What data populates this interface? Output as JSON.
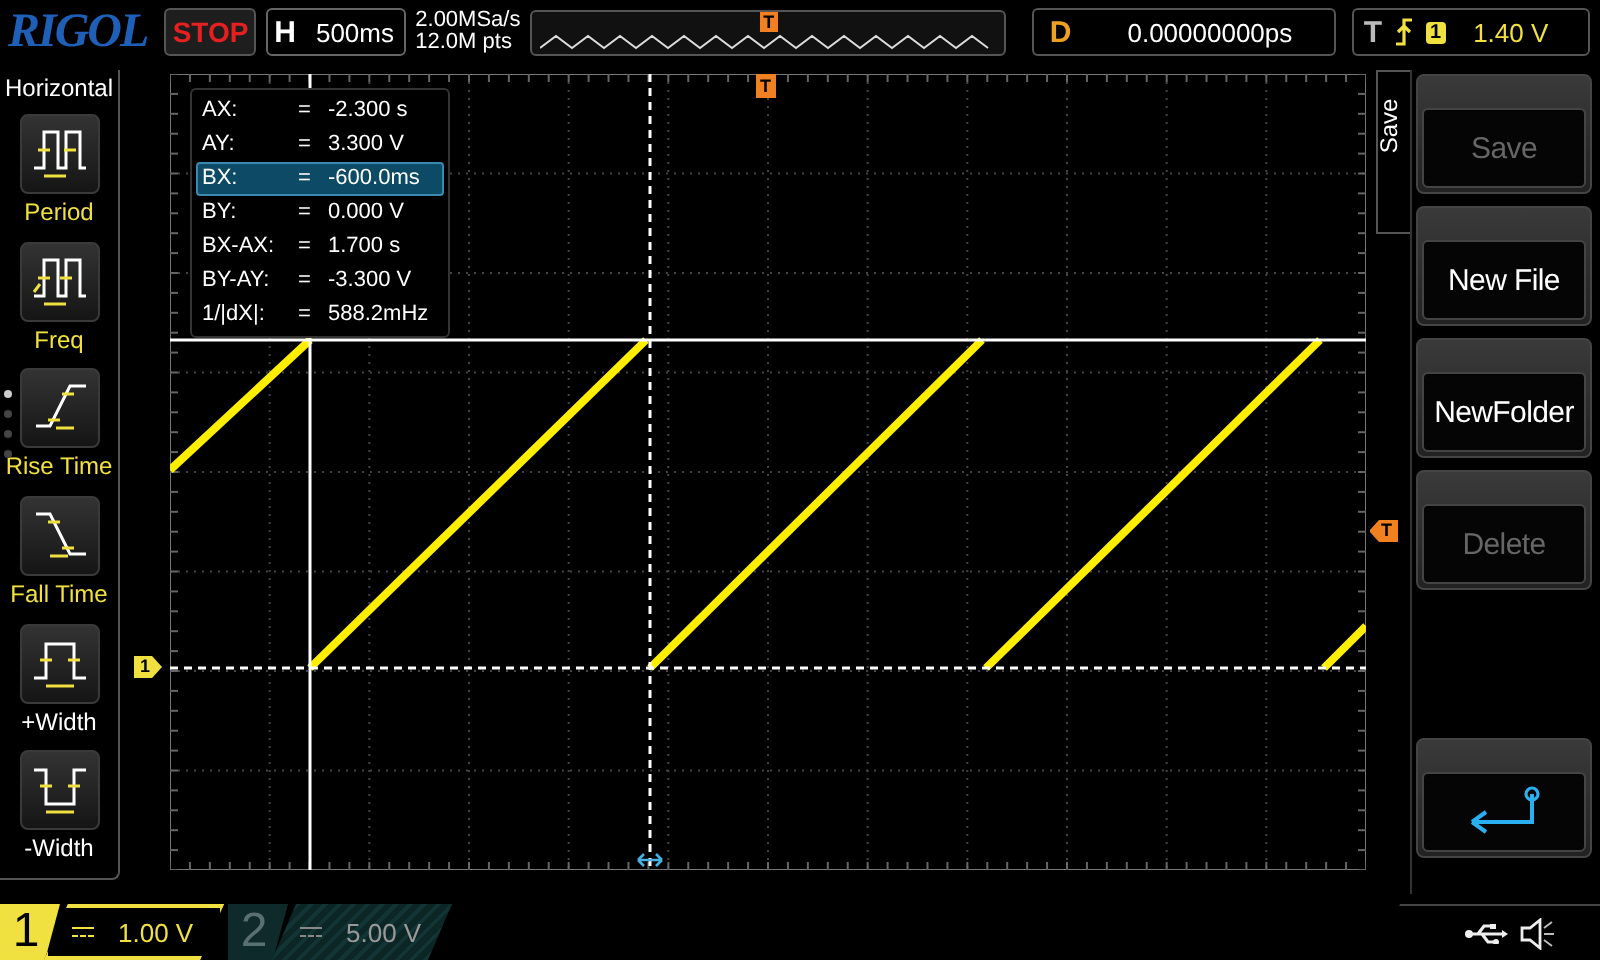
{
  "brand": "RIGOL",
  "run_state": {
    "label": "STOP",
    "kind": "stop"
  },
  "horizontal": {
    "label": "H",
    "timebase": "500ms"
  },
  "acquisition": {
    "sample_rate": "2.00MSa/s",
    "memory_depth": "12.0M pts"
  },
  "overview": {
    "trigger_marker": "T"
  },
  "delay": {
    "label": "D",
    "value": "0.00000000ps"
  },
  "trigger": {
    "label": "T",
    "source": "1",
    "trigger_level": "1.40 V"
  },
  "measure_menu": {
    "title": "Horizontal",
    "items": [
      {
        "label": "Period",
        "kind": "period",
        "color": "#f0e040"
      },
      {
        "label": "Freq",
        "kind": "freq",
        "color": "#f0e040"
      },
      {
        "label": "Rise Time",
        "kind": "rise",
        "color": "#f0e040"
      },
      {
        "label": "Fall Time",
        "kind": "fall",
        "color": "#f0e040"
      },
      {
        "label": "+Width",
        "kind": "pwidth",
        "color": "#ffffff"
      },
      {
        "label": "-Width",
        "kind": "nwidth",
        "color": "#ffffff"
      }
    ],
    "pages": [
      {
        "selected": true
      },
      {
        "selected": false
      },
      {
        "selected": false
      },
      {
        "selected": false
      }
    ]
  },
  "cursor_readout": [
    {
      "name": "AX:",
      "equals": "=",
      "value": "-2.300 s",
      "selected": false
    },
    {
      "name": "AY:",
      "equals": "=",
      "value": "3.300 V",
      "selected": false
    },
    {
      "name": "BX:",
      "equals": "=",
      "value": "-600.0ms",
      "selected": true
    },
    {
      "name": "BY:",
      "equals": "=",
      "value": "0.000 V",
      "selected": false
    },
    {
      "name": "BX-AX:",
      "equals": "=",
      "value": "1.700 s",
      "selected": false
    },
    {
      "name": "BY-AY:",
      "equals": "=",
      "value": "-3.300 V",
      "selected": false
    },
    {
      "name": "1/|dX|:",
      "equals": "=",
      "value": "588.2mHz",
      "selected": false
    }
  ],
  "markers": {
    "trigger_position": "T",
    "trigger_level": "T",
    "channel": "1"
  },
  "side_menu": {
    "title": "Save",
    "buttons": [
      {
        "kind": "text",
        "label": "Save",
        "disabled": true
      },
      {
        "kind": "text",
        "label": "New File",
        "disabled": false
      },
      {
        "kind": "text",
        "label": "NewFolder",
        "disabled": false
      },
      {
        "kind": "text",
        "label": "Delete",
        "disabled": true
      },
      {
        "kind": "return"
      }
    ]
  },
  "channels": [
    {
      "number": "1",
      "scale": "1.00 V",
      "active": true
    },
    {
      "number": "2",
      "scale": "5.00 V",
      "active": false
    }
  ]
}
